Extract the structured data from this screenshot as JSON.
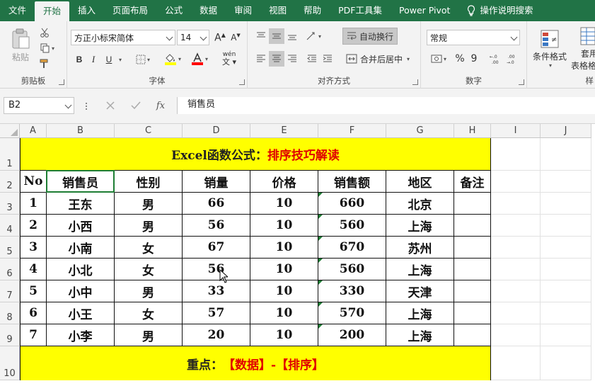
{
  "tabs": [
    "文件",
    "开始",
    "插入",
    "页面布局",
    "公式",
    "数据",
    "审阅",
    "视图",
    "帮助",
    "PDF工具集",
    "Power Pivot"
  ],
  "tell_me": "操作说明搜索",
  "ribbon": {
    "clipboard": {
      "paste": "粘贴",
      "label": "剪贴板"
    },
    "font": {
      "name": "方正小标宋简体",
      "size": "14",
      "label": "字体",
      "bold": "B",
      "italic": "I",
      "underline": "U",
      "wen": "wén"
    },
    "align": {
      "wrap": "自动换行",
      "merge": "合并后居中",
      "label": "对齐方式"
    },
    "number": {
      "format": "常规",
      "label": "数字",
      "percent": "%",
      "comma": "9"
    },
    "styles": {
      "cond": "条件格式",
      "table1": "套用",
      "table2": "表格格",
      "label": "样"
    }
  },
  "formula_bar": {
    "name_box": "B2",
    "fx": "fx",
    "value": "销售员"
  },
  "columns": [
    "A",
    "B",
    "C",
    "D",
    "E",
    "F",
    "G",
    "H",
    "I",
    "J"
  ],
  "rows": [
    "1",
    "2",
    "3",
    "4",
    "5",
    "6",
    "7",
    "8",
    "9",
    "10"
  ],
  "title": {
    "black": "Excel函数公式",
    "colon": "：",
    "red": "排序技巧解读"
  },
  "headers": [
    "No",
    "销售员",
    "性别",
    "销量",
    "价格",
    "销售额",
    "地区",
    "备注"
  ],
  "table": [
    [
      "1",
      "王东",
      "男",
      "66",
      "10",
      "660",
      "北京",
      ""
    ],
    [
      "2",
      "小西",
      "男",
      "56",
      "10",
      "560",
      "上海",
      ""
    ],
    [
      "3",
      "小南",
      "女",
      "67",
      "10",
      "670",
      "苏州",
      ""
    ],
    [
      "4",
      "小北",
      "女",
      "56",
      "10",
      "560",
      "上海",
      ""
    ],
    [
      "5",
      "小中",
      "男",
      "33",
      "10",
      "330",
      "天津",
      ""
    ],
    [
      "6",
      "小王",
      "女",
      "57",
      "10",
      "570",
      "上海",
      ""
    ],
    [
      "7",
      "小李",
      "男",
      "20",
      "10",
      "200",
      "上海",
      ""
    ]
  ],
  "footer": {
    "black": "重点：",
    "red": "【数据】-【排序】"
  },
  "colors": {
    "ribbon_green": "#217346",
    "banner": "#ffff00",
    "accent_red": "#e00000",
    "font_color_bar": "#ff0000",
    "highlight_bar": "#ffff00"
  }
}
